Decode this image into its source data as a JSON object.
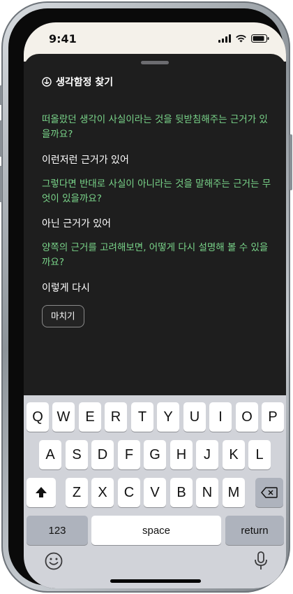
{
  "status_bar": {
    "time": "9:41"
  },
  "sheet": {
    "title": "생각함정 찾기",
    "items": [
      {
        "question": "떠올랐던 생각이 사실이라는 것을 뒷받침해주는 근거가 있을까요?",
        "answer": "이런저런 근거가 있어"
      },
      {
        "question": "그렇다면 반대로 사실이 아니라는 것을 말해주는 근거는 무엇이 있을까요?",
        "answer": "아닌 근거가 있어"
      },
      {
        "question": "양쪽의 근거를 고려해보면, 어떻게 다시 설명해 볼 수 있을까요?",
        "answer": "이렇게 다시"
      }
    ],
    "finish_button": "마치기"
  },
  "keyboard": {
    "row1": [
      "Q",
      "W",
      "E",
      "R",
      "T",
      "Y",
      "U",
      "I",
      "O",
      "P"
    ],
    "row2": [
      "A",
      "S",
      "D",
      "F",
      "G",
      "H",
      "J",
      "K",
      "L"
    ],
    "row3": [
      "Z",
      "X",
      "C",
      "V",
      "B",
      "N",
      "M"
    ],
    "numbers_key": "123",
    "space_key": "space",
    "return_key": "return"
  },
  "colors": {
    "question_text": "#7ad58a",
    "sheet_bg": "#1e1e1e",
    "keyboard_bg": "#d1d3d9"
  }
}
